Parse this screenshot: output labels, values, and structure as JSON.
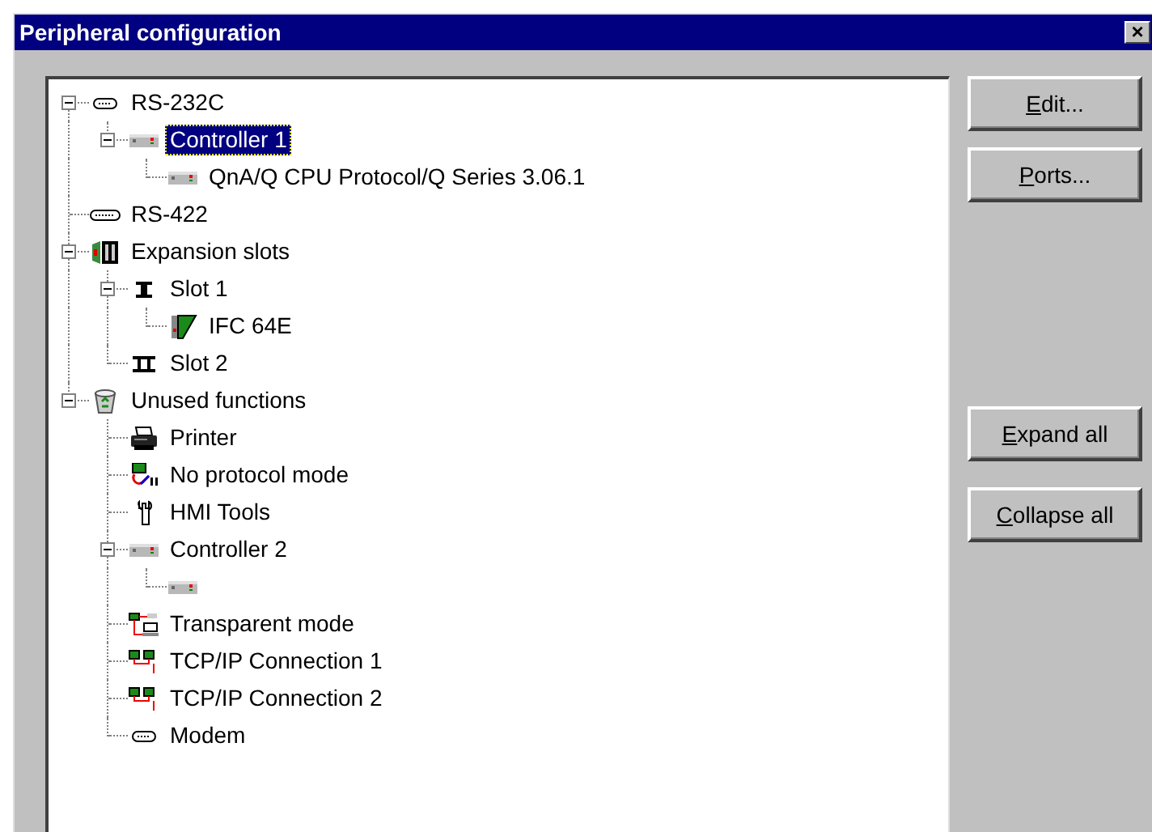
{
  "window": {
    "title": "Peripheral configuration",
    "close_glyph": "×"
  },
  "tree": [
    {
      "label": "RS-232C",
      "kind": "serial",
      "selected": false,
      "expanded": true,
      "children": [
        {
          "label": "Controller 1",
          "kind": "controller",
          "selected": true,
          "expanded": true,
          "children": [
            {
              "label": "QnA/Q CPU Protocol/Q Series 3.06.1",
              "kind": "controller",
              "selected": false
            }
          ]
        }
      ]
    },
    {
      "label": "RS-422",
      "kind": "serial-wide",
      "selected": false
    },
    {
      "label": "Expansion slots",
      "kind": "slots",
      "selected": false,
      "expanded": true,
      "children": [
        {
          "label": "Slot 1",
          "kind": "slot-one",
          "selected": false,
          "expanded": true,
          "children": [
            {
              "label": "IFC 64E",
              "kind": "card",
              "selected": false
            }
          ]
        },
        {
          "label": "Slot 2",
          "kind": "slot-two",
          "selected": false
        }
      ]
    },
    {
      "label": "Unused functions",
      "kind": "bin",
      "selected": false,
      "expanded": true,
      "children": [
        {
          "label": "Printer",
          "kind": "printer",
          "selected": false
        },
        {
          "label": "No protocol mode",
          "kind": "noprotocol",
          "selected": false
        },
        {
          "label": "HMI Tools",
          "kind": "wrench",
          "selected": false
        },
        {
          "label": "Controller 2",
          "kind": "controller",
          "selected": false,
          "expanded": true,
          "children": [
            {
              "kind": "controller",
              "selected": false
            }
          ]
        },
        {
          "label": "Transparent mode",
          "kind": "transparent",
          "selected": false
        },
        {
          "label": "TCP/IP Connection 1",
          "kind": "network",
          "selected": false
        },
        {
          "label": "TCP/IP Connection 2",
          "kind": "network",
          "selected": false
        },
        {
          "label": "Modem",
          "kind": "serial",
          "selected": false
        }
      ]
    }
  ],
  "buttons_top": [
    {
      "accel": "E",
      "rest": "dit..."
    },
    {
      "accel": "P",
      "rest": "orts..."
    }
  ],
  "buttons_bottom": [
    {
      "accel": "E",
      "rest": "xpand all"
    },
    {
      "accel": "C",
      "rest": "ollapse all"
    }
  ]
}
